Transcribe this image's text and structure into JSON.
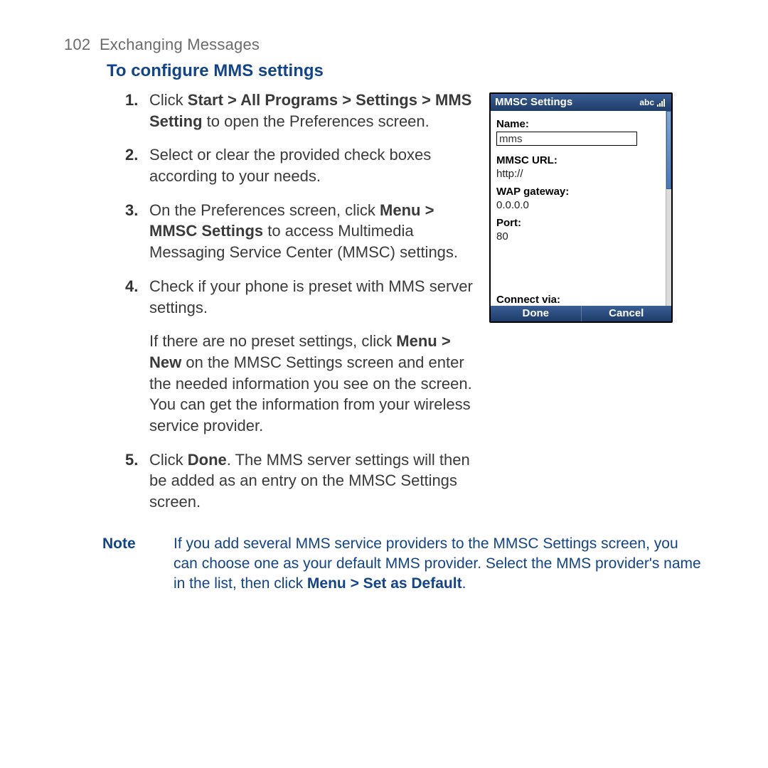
{
  "header": {
    "page_number": "102",
    "chapter": "Exchanging Messages"
  },
  "section_title": "To configure MMS settings",
  "steps": {
    "1": {
      "num": "1.",
      "pre": "Click ",
      "b1": "Start > All Programs > Settings > MMS Setting",
      "post": " to open the Preferences screen."
    },
    "2": {
      "num": "2.",
      "text": "Select or clear the provided check boxes according to your needs."
    },
    "3": {
      "num": "3.",
      "pre": "On the Preferences screen, click ",
      "b1": "Menu > MMSC Settings",
      "post": " to access Multimedia Messaging Service Center (MMSC) settings."
    },
    "4": {
      "num": "4.",
      "line1": "Check if your phone is preset with MMS server settings.",
      "f_pre": "If there are no preset settings, click ",
      "f_b1": "Menu > New",
      "f_post": " on the MMSC Settings screen and enter the needed information you see on the screen. You can get the information from your wireless service provider."
    },
    "5": {
      "num": "5.",
      "pre": "Click ",
      "b1": "Done",
      "post": ". The MMS server settings will then be added as an entry on the MMSC Settings screen."
    }
  },
  "note": {
    "label": "Note",
    "pre": "If you add several MMS service providers to the MMSC Settings screen, you can choose one as your default MMS provider. Select the MMS provider's name in the list, then click ",
    "b1": "Menu > Set as Default",
    "post": "."
  },
  "phone": {
    "title": "MMSC Settings",
    "abc": "abc",
    "fields": {
      "name_label": "Name:",
      "name_value": "mms",
      "url_label": "MMSC URL:",
      "url_value": "http://",
      "wap_label": "WAP gateway:",
      "wap_value": "0.0.0.0",
      "port_label": "Port:",
      "port_value": "80",
      "connect_label": "Connect via:"
    },
    "softkeys": {
      "left": "Done",
      "right": "Cancel"
    }
  }
}
